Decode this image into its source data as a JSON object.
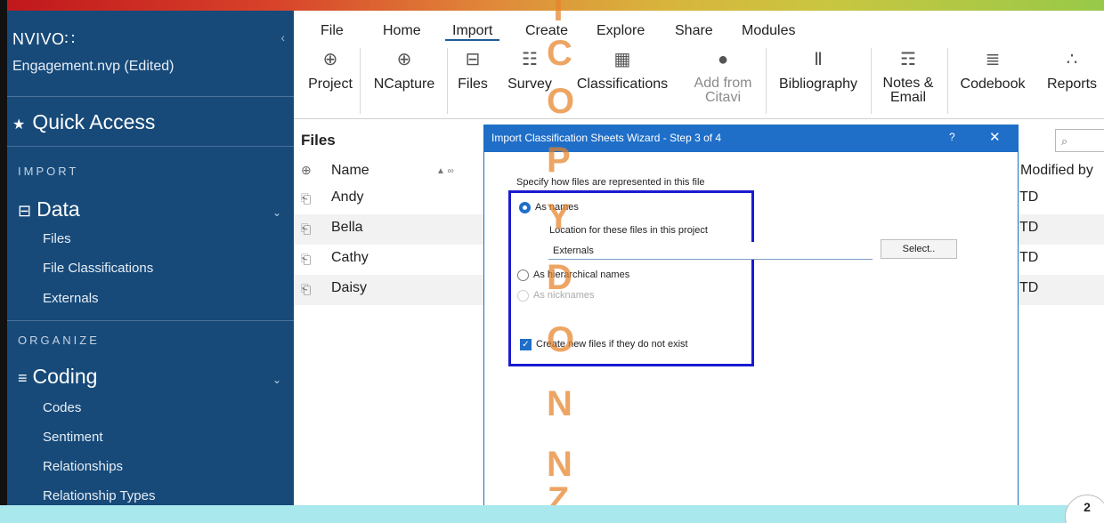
{
  "sidebar": {
    "app_name": "NVIVO",
    "app_logo": "∷",
    "collapse_glyph": "‹",
    "project": "Engagement.nvp (Edited)",
    "quick_access": "Quick Access",
    "sections": {
      "import": "IMPORT",
      "organize": "ORGANIZE"
    },
    "data_group": "Data",
    "data_items": [
      "Files",
      "File Classifications",
      "Externals"
    ],
    "coding_group": "Coding",
    "coding_items": [
      "Codes",
      "Sentiment",
      "Relationships",
      "Relationship Types"
    ],
    "colors": {
      "bg": "#174a79"
    }
  },
  "ribbon": {
    "tabs": [
      "File",
      "Home",
      "Import",
      "Create",
      "Explore",
      "Share",
      "Modules"
    ],
    "active_tab": "Import",
    "buttons": [
      {
        "label": "Project",
        "icon": "plus-circle-icon",
        "glyph": "⊕"
      },
      {
        "label": "NCapture",
        "icon": "globe-icon",
        "glyph": "⊕"
      },
      {
        "label": "Files",
        "icon": "file-import-icon",
        "glyph": "⊟"
      },
      {
        "label": "Survey",
        "icon": "survey-icon",
        "glyph": "☷"
      },
      {
        "label": "Classifications",
        "icon": "grid-icon",
        "glyph": "▦"
      },
      {
        "label": "Add from",
        "label2": "Citavi",
        "icon": "citavi-icon",
        "glyph": "●"
      },
      {
        "label": "Bibliography",
        "icon": "books-icon",
        "glyph": "Ⅱ"
      },
      {
        "label": "Notes &",
        "label2": "Email",
        "icon": "notes-icon",
        "glyph": "☶"
      },
      {
        "label": "Codebook",
        "icon": "codebook-icon",
        "glyph": "≣"
      },
      {
        "label": "Reports",
        "icon": "reports-icon",
        "glyph": "∴"
      }
    ]
  },
  "files": {
    "header": "Files",
    "search_placeholder": "⌕",
    "columns": {
      "name": "Name",
      "modified_by": "Modified by"
    },
    "rows": [
      {
        "name": "Andy",
        "modified_by": "TD"
      },
      {
        "name": "Bella",
        "modified_by": "TD"
      },
      {
        "name": "Cathy",
        "modified_by": "TD"
      },
      {
        "name": "Daisy",
        "modified_by": "TD"
      }
    ]
  },
  "dialog": {
    "title": "Import Classification Sheets Wizard - Step 3 of 4",
    "help": "?",
    "close": "✕",
    "intro": "Specify how files are represented in this file",
    "options": {
      "as_names": "As names",
      "as_hierarchical": "As hierarchical names",
      "as_nicknames": "As nicknames"
    },
    "selected_option": "as_names",
    "location_label": "Location for these files in this project",
    "location_value": "Externals",
    "select_button": "Select..",
    "create_label": "Create new files if they do not exist",
    "create_checked": true,
    "colors": {
      "title_bg": "#1f6fc9",
      "highlight": "#1a1ad0"
    }
  },
  "watermark": [
    "T",
    "C",
    "O",
    "P",
    "Y",
    "D",
    "O",
    "N",
    "N",
    "Z"
  ],
  "page_badge": "2"
}
